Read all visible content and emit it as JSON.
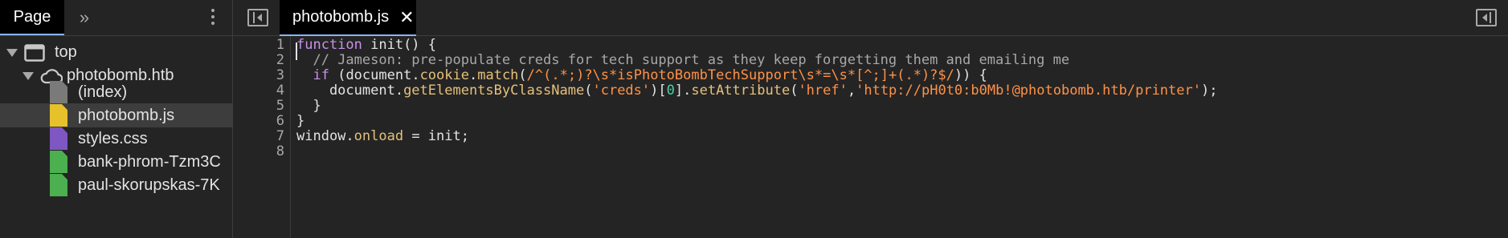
{
  "sidebar": {
    "tabs": {
      "page": "Page",
      "more": "»"
    },
    "tree": [
      {
        "label": "top",
        "icon": "frame-icon"
      },
      {
        "label": "photobomb.htb",
        "icon": "cloud-icon"
      },
      {
        "label": "(index)",
        "icon": "file-icon",
        "color": "#7a7a7a"
      },
      {
        "label": "photobomb.js",
        "icon": "file-icon",
        "color": "#e6c12b",
        "selected": true
      },
      {
        "label": "styles.css",
        "icon": "file-icon",
        "color": "#7e57c2"
      },
      {
        "label": "bank-phrom-Tzm3C",
        "icon": "file-icon",
        "color": "#4caf50"
      },
      {
        "label": "paul-skorupskas-7K",
        "icon": "file-icon",
        "color": "#4caf50"
      }
    ]
  },
  "editor": {
    "tab": {
      "label": "photobomb.js",
      "close": "✕"
    },
    "line_numbers": [
      "1",
      "2",
      "3",
      "4",
      "5",
      "6",
      "7",
      "8"
    ],
    "code": {
      "l1": {
        "kw": "function",
        "rest": " init() {"
      },
      "l2": {
        "comment": "  // Jameson: pre-populate creds for tech support as they keep forgetting them and emailing me"
      },
      "l3": {
        "indent": "  ",
        "kw": "if",
        "a": " (document.",
        "method": "cookie",
        "b": ".",
        "match": "match",
        "c": "(",
        "regex": "/^(.*;)?\\s*isPhotoBombTechSupport\\s*=\\s*[^;]+(.*)?$/",
        "d": ")) {"
      },
      "l4": {
        "indent": "    document.",
        "fn1": "getElementsByClassName",
        "a": "(",
        "s1": "'creds'",
        "b": ")[",
        "num": "0",
        "c": "].",
        "fn2": "setAttribute",
        "d": "(",
        "s2": "'href'",
        "e": ",",
        "s3": "'http://pH0t0:b0Mb!@photobomb.htb/printer'",
        "f": ");"
      },
      "l5": {
        "text": "  }"
      },
      "l6": {
        "text": "}"
      },
      "l7": {
        "a": "window.",
        "prop": "onload",
        "b": " = init;"
      },
      "l8": {
        "text": ""
      }
    }
  },
  "colors": {
    "background": "#242424",
    "accent": "#8ab4f8",
    "keyword": "#c792ea",
    "string": "#ff9248",
    "function": "#e6c07b",
    "comment": "#a8a8a8"
  }
}
